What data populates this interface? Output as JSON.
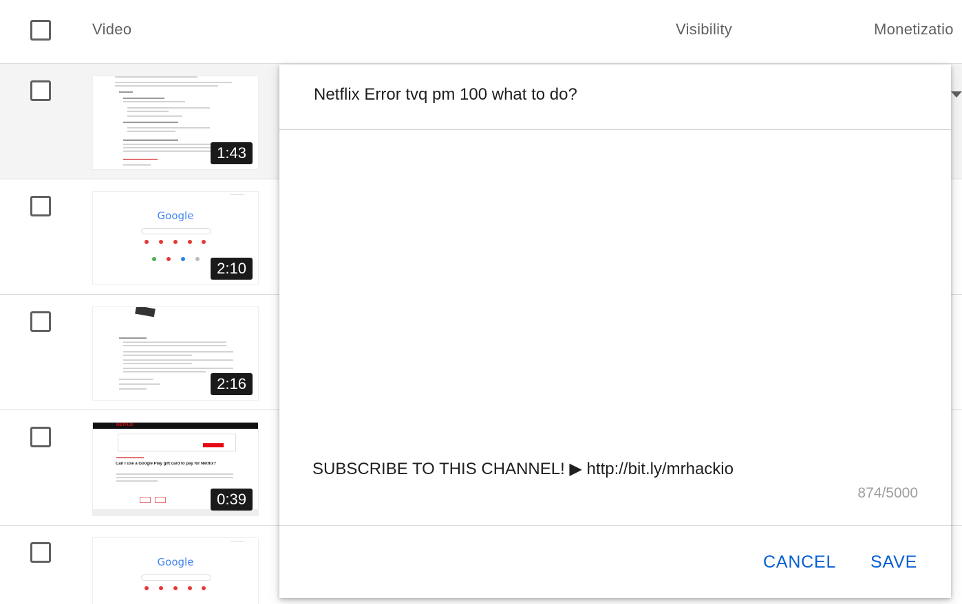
{
  "header": {
    "video_label": "Video",
    "visibility_label": "Visibility",
    "monetization_label": "Monetizatio"
  },
  "rows": [
    {
      "duration": "1:43",
      "thumb": "help-article"
    },
    {
      "duration": "2:10",
      "thumb": "google-homepage",
      "logo_text": "Google"
    },
    {
      "duration": "2:16",
      "thumb": "help-article-router"
    },
    {
      "duration": "0:39",
      "thumb": "netflix-help-center",
      "brand_text": "NETFLIX",
      "headline": "Can I use a Google Play gift card to pay for Netflix?"
    },
    {
      "duration": "",
      "thumb": "google-homepage",
      "logo_text": "Google"
    }
  ],
  "edit_panel": {
    "title_value": "Netflix Error tvq pm 100 what to do?",
    "description_line": "SUBSCRIBE TO THIS CHANNEL! ▶ http://bit.ly/mrhackio",
    "char_count": "874/5000",
    "cancel_label": "CANCEL",
    "save_label": "SAVE"
  },
  "accent_color": "#065fd4"
}
